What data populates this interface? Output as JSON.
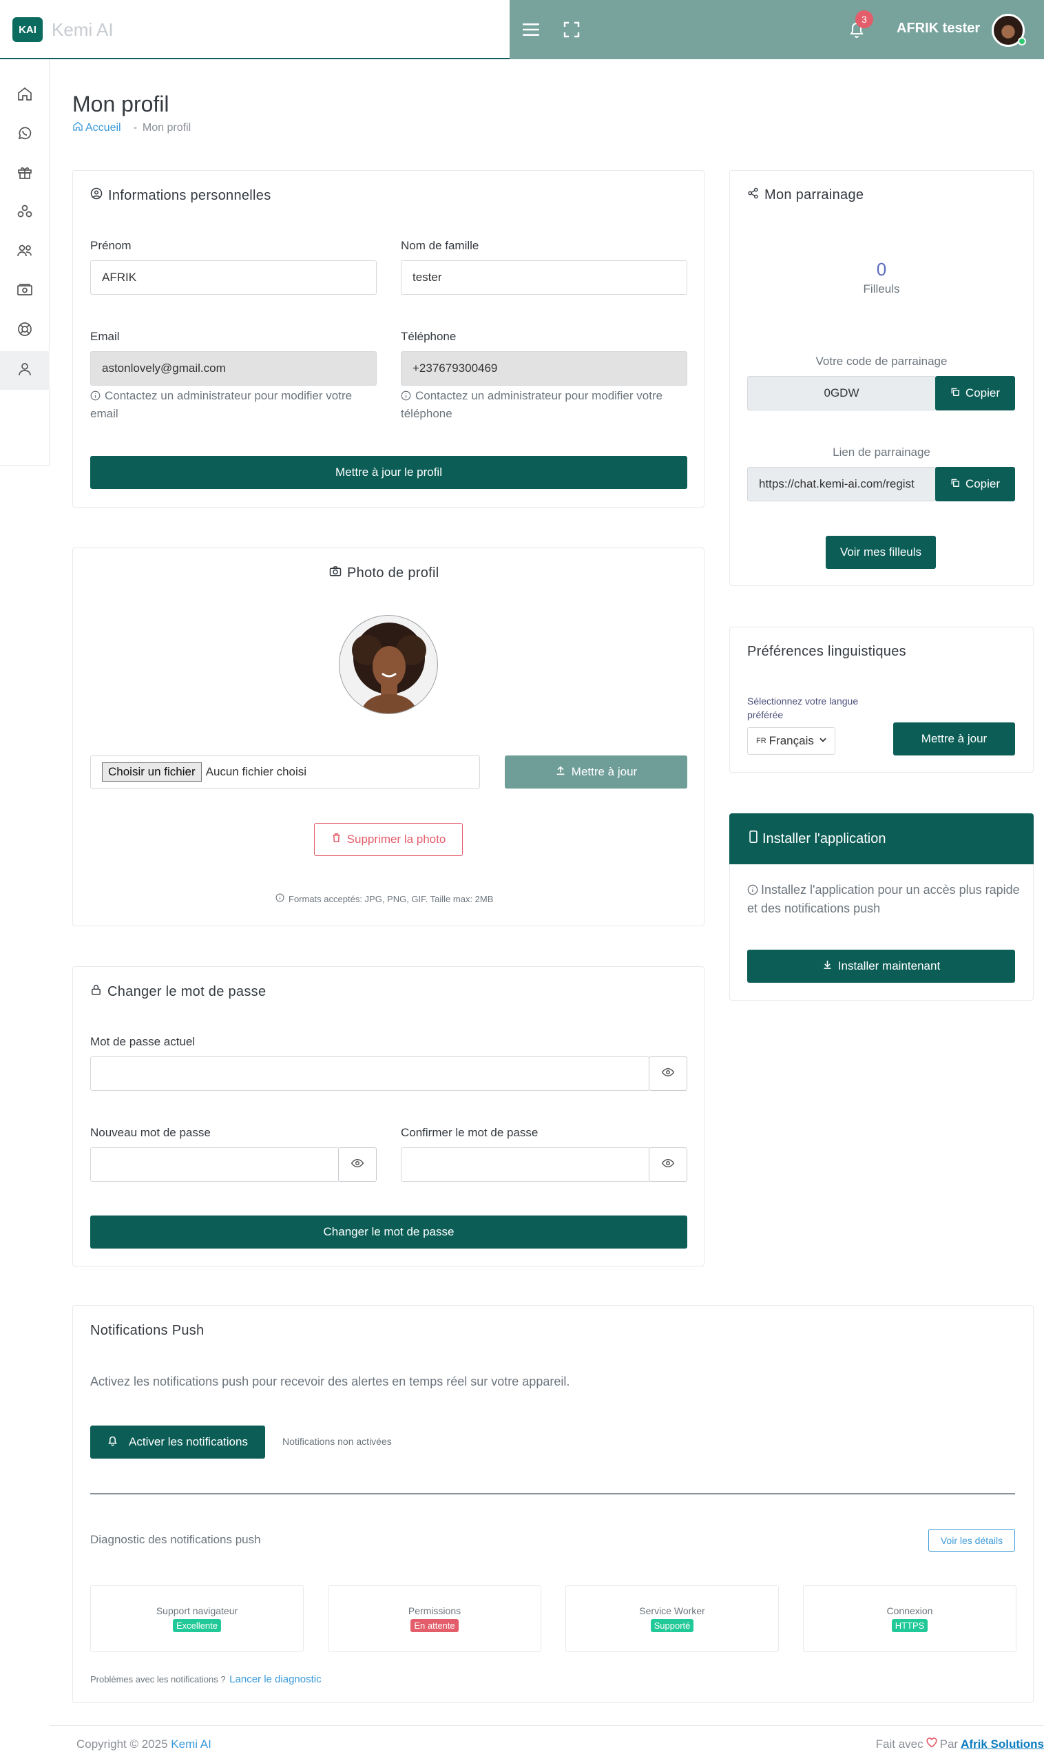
{
  "brand": {
    "logo_text": "KAI",
    "name": "Kemi AI"
  },
  "topbar": {
    "notif_count": "3",
    "user_name": "AFRIK tester"
  },
  "sidebar": {
    "items": [
      "home",
      "whatsapp",
      "gift",
      "groups",
      "team",
      "money",
      "support",
      "profile"
    ]
  },
  "page": {
    "title": "Mon profil",
    "breadcrumb_home": "Accueil",
    "breadcrumb_sep": "-",
    "breadcrumb_current": "Mon profil"
  },
  "personal": {
    "title": "Informations personnelles",
    "first_name_label": "Prénom",
    "first_name_value": "AFRIK",
    "last_name_label": "Nom de famille",
    "last_name_value": "tester",
    "email_label": "Email",
    "email_value": "astonlovely@gmail.com",
    "email_hint": "Contactez un administrateur pour modifier votre email",
    "phone_label": "Téléphone",
    "phone_value": "+237679300469",
    "phone_hint": "Contactez un administrateur pour modifier votre téléphone",
    "submit_label": "Mettre à jour le profil"
  },
  "photo": {
    "title": "Photo de profil",
    "choose_file_label": "Choisir un fichier",
    "no_file_label": "Aucun fichier choisi",
    "update_label": "Mettre à jour",
    "delete_label": "Supprimer la photo",
    "formats_hint": "Formats acceptés: JPG, PNG, GIF. Taille max: 2MB"
  },
  "password": {
    "title": "Changer le mot de passe",
    "current_label": "Mot de passe actuel",
    "new_label": "Nouveau mot de passe",
    "confirm_label": "Confirmer le mot de passe",
    "submit_label": "Changer le mot de passe"
  },
  "referral": {
    "title": "Mon parrainage",
    "count": "0",
    "count_label": "Filleuls",
    "code_label": "Votre code de parrainage",
    "code_value": "0GDW",
    "copy_label": "Copier",
    "link_label": "Lien de parrainage",
    "link_value": "https://chat.kemi-ai.com/regist",
    "view_label": "Voir mes filleuls"
  },
  "language": {
    "title": "Préférences linguistiques",
    "select_label": "Sélectionnez votre langue préférée",
    "selected_value": "Français",
    "flag_code": "FR",
    "update_label": "Mettre à jour"
  },
  "install": {
    "title": "Installer l'application",
    "description": "Installez l'application pour un accès plus rapide et des notifications push",
    "button_label": "Installer maintenant"
  },
  "push": {
    "title": "Notifications Push",
    "description": "Activez les notifications push pour recevoir des alertes en temps réel sur votre appareil.",
    "activate_label": "Activer les notifications",
    "status_text": "Notifications non activées",
    "diag_title": "Diagnostic des notifications push",
    "details_label": "Voir les détails",
    "diagnostics": [
      {
        "label": "Support navigateur",
        "badge": "Excellente",
        "color": "#20c997"
      },
      {
        "label": "Permissions",
        "badge": "En attente",
        "color": "#e35d6a"
      },
      {
        "label": "Service Worker",
        "badge": "Supporté",
        "color": "#20c997"
      },
      {
        "label": "Connexion",
        "badge": "HTTPS",
        "color": "#20c997"
      }
    ],
    "problem_text": "Problèmes avec les notifications ?",
    "diagnose_link": "Lancer le diagnostic"
  },
  "footer": {
    "copyright": "Copyright © 2025",
    "copyright_brand": "Kemi AI",
    "made_with": "Fait avec",
    "made_by_prefix": "Par",
    "made_by": "Afrik Solutions"
  },
  "colors": {
    "primary": "#0b5d56",
    "topbar": "#77a39c",
    "danger": "#e35d6a",
    "success": "#20c997",
    "link": "#3b9ad9"
  }
}
